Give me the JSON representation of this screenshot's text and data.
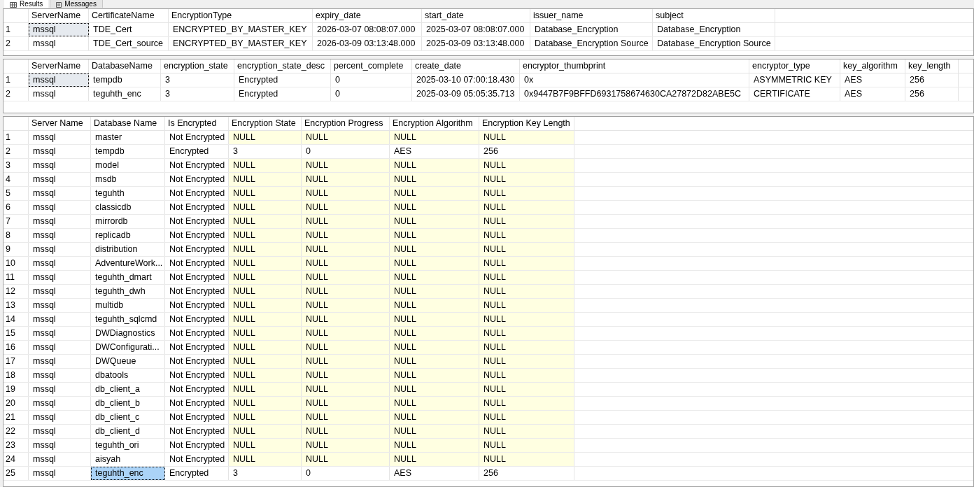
{
  "tabs": [
    {
      "label": "Results",
      "selected": true
    },
    {
      "label": "Messages",
      "selected": false
    }
  ],
  "grids": [
    {
      "active": false,
      "columns": [
        "ServerName",
        "CertificateName",
        "EncryptionType",
        "expiry_date",
        "start_date",
        "issuer_name",
        "subject"
      ],
      "rows": [
        {
          "num": "1",
          "highlighted": false,
          "selected": [
            true,
            false,
            false,
            false,
            false,
            false,
            false
          ],
          "cells": [
            "mssql",
            "TDE_Cert",
            "ENCRYPTED_BY_MASTER_KEY",
            "2026-03-07 08:08:07.000",
            "2025-03-07 08:08:07.000",
            "Database_Encryption",
            "Database_Encryption"
          ]
        },
        {
          "num": "2",
          "highlighted": false,
          "selected": [
            false,
            false,
            false,
            false,
            false,
            false,
            false
          ],
          "cells": [
            "mssql",
            "TDE_Cert_source",
            "ENCRYPTED_BY_MASTER_KEY",
            "2026-03-09 03:13:48.000",
            "2025-03-09 03:13:48.000",
            "Database_Encryption Source",
            "Database_Encryption Source"
          ]
        }
      ]
    },
    {
      "active": false,
      "columns": [
        "ServerName",
        "DatabaseName",
        "encryption_state",
        "encryption_state_desc",
        "percent_complete",
        "create_date",
        "encryptor_thumbprint",
        "encryptor_type",
        "key_algorithm",
        "key_length"
      ],
      "rows": [
        {
          "num": "1",
          "highlighted": false,
          "selected": [
            true,
            false,
            false,
            false,
            false,
            false,
            false,
            false,
            false,
            false
          ],
          "cells": [
            "mssql",
            "tempdb",
            "3",
            "Encrypted",
            "0",
            "2025-03-10 07:00:18.430",
            "0x",
            "ASYMMETRIC KEY",
            "AES",
            "256"
          ]
        },
        {
          "num": "2",
          "highlighted": false,
          "selected": [
            false,
            false,
            false,
            false,
            false,
            false,
            false,
            false,
            false,
            false
          ],
          "cells": [
            "mssql",
            "teguhth_enc",
            "3",
            "Encrypted",
            "0",
            "2025-03-09 05:05:35.713",
            "0x9447B7F9BFFD6931758674630CA27872D82ABE5C",
            "CERTIFICATE",
            "AES",
            "256"
          ]
        }
      ]
    },
    {
      "active": true,
      "columns": [
        "Server Name",
        "Database Name",
        "Is Encrypted",
        "Encryption State",
        "Encryption Progress",
        "Encryption Algorithm",
        "Encryption Key Length"
      ],
      "rows": [
        {
          "num": "1",
          "highlighted": true,
          "cells": [
            "mssql",
            "master",
            "Not Encrypted",
            "NULL",
            "NULL",
            "NULL",
            "NULL"
          ]
        },
        {
          "num": "2",
          "highlighted": false,
          "cells": [
            "mssql",
            "tempdb",
            "Encrypted",
            "3",
            "0",
            "AES",
            "256"
          ]
        },
        {
          "num": "3",
          "highlighted": true,
          "cells": [
            "mssql",
            "model",
            "Not Encrypted",
            "NULL",
            "NULL",
            "NULL",
            "NULL"
          ]
        },
        {
          "num": "4",
          "highlighted": true,
          "cells": [
            "mssql",
            "msdb",
            "Not Encrypted",
            "NULL",
            "NULL",
            "NULL",
            "NULL"
          ]
        },
        {
          "num": "5",
          "highlighted": true,
          "cells": [
            "mssql",
            "teguhth",
            "Not Encrypted",
            "NULL",
            "NULL",
            "NULL",
            "NULL"
          ]
        },
        {
          "num": "6",
          "highlighted": true,
          "cells": [
            "mssql",
            "classicdb",
            "Not Encrypted",
            "NULL",
            "NULL",
            "NULL",
            "NULL"
          ]
        },
        {
          "num": "7",
          "highlighted": true,
          "cells": [
            "mssql",
            "mirrordb",
            "Not Encrypted",
            "NULL",
            "NULL",
            "NULL",
            "NULL"
          ]
        },
        {
          "num": "8",
          "highlighted": true,
          "cells": [
            "mssql",
            "replicadb",
            "Not Encrypted",
            "NULL",
            "NULL",
            "NULL",
            "NULL"
          ]
        },
        {
          "num": "9",
          "highlighted": true,
          "cells": [
            "mssql",
            "distribution",
            "Not Encrypted",
            "NULL",
            "NULL",
            "NULL",
            "NULL"
          ]
        },
        {
          "num": "10",
          "highlighted": true,
          "cells": [
            "mssql",
            "AdventureWork...",
            "Not Encrypted",
            "NULL",
            "NULL",
            "NULL",
            "NULL"
          ]
        },
        {
          "num": "11",
          "highlighted": true,
          "cells": [
            "mssql",
            "teguhth_dmart",
            "Not Encrypted",
            "NULL",
            "NULL",
            "NULL",
            "NULL"
          ]
        },
        {
          "num": "12",
          "highlighted": true,
          "cells": [
            "mssql",
            "teguhth_dwh",
            "Not Encrypted",
            "NULL",
            "NULL",
            "NULL",
            "NULL"
          ]
        },
        {
          "num": "13",
          "highlighted": true,
          "cells": [
            "mssql",
            "multidb",
            "Not Encrypted",
            "NULL",
            "NULL",
            "NULL",
            "NULL"
          ]
        },
        {
          "num": "14",
          "highlighted": true,
          "cells": [
            "mssql",
            "teguhth_sqlcmd",
            "Not Encrypted",
            "NULL",
            "NULL",
            "NULL",
            "NULL"
          ]
        },
        {
          "num": "15",
          "highlighted": true,
          "cells": [
            "mssql",
            "DWDiagnostics",
            "Not Encrypted",
            "NULL",
            "NULL",
            "NULL",
            "NULL"
          ]
        },
        {
          "num": "16",
          "highlighted": true,
          "cells": [
            "mssql",
            "DWConfigurati...",
            "Not Encrypted",
            "NULL",
            "NULL",
            "NULL",
            "NULL"
          ]
        },
        {
          "num": "17",
          "highlighted": true,
          "cells": [
            "mssql",
            "DWQueue",
            "Not Encrypted",
            "NULL",
            "NULL",
            "NULL",
            "NULL"
          ]
        },
        {
          "num": "18",
          "highlighted": true,
          "cells": [
            "mssql",
            "dbatools",
            "Not Encrypted",
            "NULL",
            "NULL",
            "NULL",
            "NULL"
          ]
        },
        {
          "num": "19",
          "highlighted": true,
          "cells": [
            "mssql",
            "db_client_a",
            "Not Encrypted",
            "NULL",
            "NULL",
            "NULL",
            "NULL"
          ]
        },
        {
          "num": "20",
          "highlighted": true,
          "cells": [
            "mssql",
            "db_client_b",
            "Not Encrypted",
            "NULL",
            "NULL",
            "NULL",
            "NULL"
          ]
        },
        {
          "num": "21",
          "highlighted": true,
          "cells": [
            "mssql",
            "db_client_c",
            "Not Encrypted",
            "NULL",
            "NULL",
            "NULL",
            "NULL"
          ]
        },
        {
          "num": "22",
          "highlighted": true,
          "cells": [
            "mssql",
            "db_client_d",
            "Not Encrypted",
            "NULL",
            "NULL",
            "NULL",
            "NULL"
          ]
        },
        {
          "num": "23",
          "highlighted": true,
          "cells": [
            "mssql",
            "teguhth_ori",
            "Not Encrypted",
            "NULL",
            "NULL",
            "NULL",
            "NULL"
          ]
        },
        {
          "num": "24",
          "highlighted": true,
          "cells": [
            "mssql",
            "aisyah",
            "Not Encrypted",
            "NULL",
            "NULL",
            "NULL",
            "NULL"
          ]
        },
        {
          "num": "25",
          "highlighted": false,
          "selected": [
            false,
            true,
            false,
            false,
            false,
            false,
            false
          ],
          "cells": [
            "mssql",
            "teguhth_enc",
            "Encrypted",
            "3",
            "0",
            "AES",
            "256"
          ]
        }
      ]
    }
  ]
}
